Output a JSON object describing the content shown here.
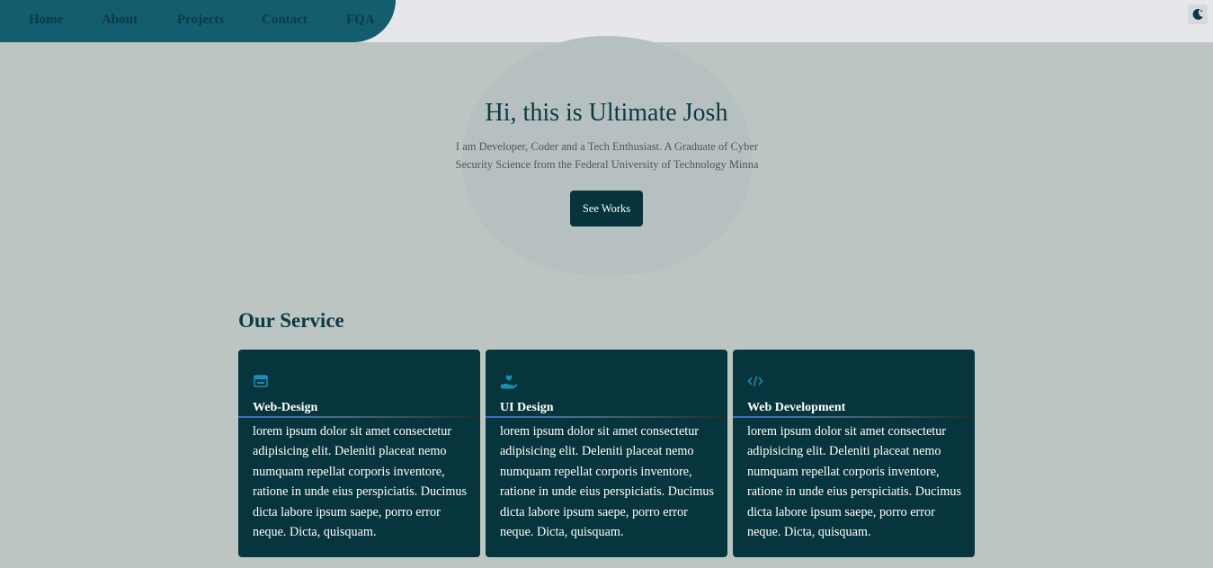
{
  "nav": {
    "items": [
      {
        "label": "Home"
      },
      {
        "label": "About"
      },
      {
        "label": "Projects"
      },
      {
        "label": "Contact"
      },
      {
        "label": "FQA"
      }
    ]
  },
  "theme_toggle": {
    "icon": "moon-icon"
  },
  "hero": {
    "title": "Hi, this is Ultimate Josh",
    "subtitle": "I am Developer, Coder and a Tech Enthusiast. A Graduate of Cyber Security Science from the Federal University of Technology Minna",
    "button_label": "See Works"
  },
  "services": {
    "heading": "Our Service",
    "cards": [
      {
        "icon": "browser-window-icon",
        "title": "Web-Design",
        "text": "lorem ipsum dolor sit amet consectetur adipisicing elit. Deleniti placeat nemo numquam repellat corporis inventore, ratione in unde eius perspiciatis. Ducimus dicta labore ipsum saepe, porro error neque. Dicta, quisquam."
      },
      {
        "icon": "hand-heart-icon",
        "title": "UI Design",
        "text": "lorem ipsum dolor sit amet consectetur adipisicing elit. Deleniti placeat nemo numquam repellat corporis inventore, ratione in unde eius perspiciatis. Ducimus dicta labore ipsum saepe, porro error neque. Dicta, quisquam."
      },
      {
        "icon": "code-icon",
        "title": "Web Development",
        "text": "lorem ipsum dolor sit amet consectetur adipisicing elit. Deleniti placeat nemo numquam repellat corporis inventore, ratione in unde eius perspiciatis. Ducimus dicta labore ipsum saepe, porro error neque. Dicta, quisquam."
      }
    ]
  },
  "colors": {
    "page_bg": "#bcc5c2",
    "nav_bg": "#145d6f",
    "card_bg": "#07353d",
    "accent": "#1c8fb4",
    "text_dark": "#0b3a44"
  }
}
